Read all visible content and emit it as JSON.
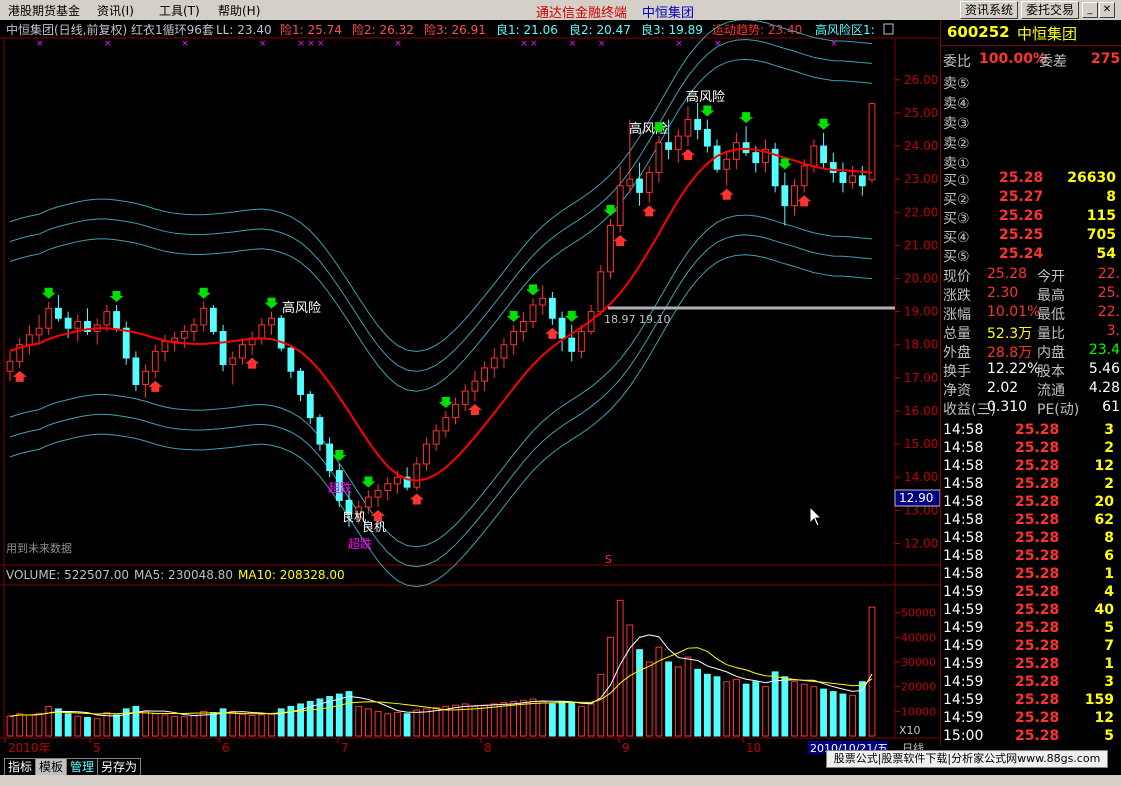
{
  "menu": {
    "items": [
      "港股期货基金",
      "资讯(I)",
      "工具(T)",
      "帮助(H)"
    ],
    "center_left": "通达信金融终端",
    "center_right": "中恒集团",
    "btn_info": "资讯系统",
    "btn_trade": "委托交易"
  },
  "colors": {
    "bg": "#000000",
    "up": "#ff3232",
    "down": "#54ffff",
    "ma": "#ff0000",
    "band": "#3fa0b0",
    "axis": "#c00000",
    "label_yellow": "#ffff00",
    "label_purple": "#ff00ff"
  },
  "indicator_line": {
    "title": "中恒集团(日线,前复权) 红衣1循环96套",
    "ll": "LL: 23.40",
    "xian1": "险1: 25.74",
    "xian2": "险2: 26.32",
    "xian3": "险3: 26.91",
    "liang1": "良1: 21.06",
    "liang2": "良2: 20.47",
    "liang3": "良3: 19.89",
    "trend": "运动趋势: 23.40",
    "risk": "高风险区1:"
  },
  "chart_annotations": {
    "high_risk": "高风险",
    "good": "良机",
    "hot": "超跌",
    "level_label": "18.97 19.10",
    "future_data": "用到未来数据",
    "cursor_price": "12.90",
    "s_mark": "S"
  },
  "volume_line": {
    "volume": "VOLUME: 522507.00",
    "ma5": "MA5: 230048.80",
    "ma10": "MA10: 208328.00",
    "x10": "X10"
  },
  "time_axis": {
    "labels": [
      "2010年",
      "5",
      "6",
      "7",
      "8",
      "9",
      "10"
    ],
    "current_date": "2010/10/21/五",
    "end_label": "日线"
  },
  "bottom_tabs": [
    "指标",
    "模板",
    "管理",
    "另存为"
  ],
  "promo": "股票公式|股票软件下载|分析家公式网www.88gs.com",
  "quote": {
    "code": "600252",
    "name": "中恒集团",
    "weibi_label": "委比",
    "weibi_value": "100.00%",
    "weicha_label": "委差",
    "weicha_value": "275",
    "sell": [
      {
        "label": "卖⑤",
        "price": "",
        "vol": ""
      },
      {
        "label": "卖④",
        "price": "",
        "vol": ""
      },
      {
        "label": "卖③",
        "price": "",
        "vol": ""
      },
      {
        "label": "卖②",
        "price": "",
        "vol": ""
      },
      {
        "label": "卖①",
        "price": "",
        "vol": ""
      }
    ],
    "buy": [
      {
        "label": "买①",
        "price": "25.28",
        "vol": "26630"
      },
      {
        "label": "买②",
        "price": "25.27",
        "vol": "8"
      },
      {
        "label": "买③",
        "price": "25.26",
        "vol": "115"
      },
      {
        "label": "买④",
        "price": "25.25",
        "vol": "705"
      },
      {
        "label": "买⑤",
        "price": "25.24",
        "vol": "54"
      }
    ],
    "stats": [
      {
        "l1": "现价",
        "v1": "25.28",
        "c1": "#ff3232",
        "l2": "今开",
        "v2": "22.",
        "c2": "#ff3232"
      },
      {
        "l1": "涨跌",
        "v1": "2.30",
        "c1": "#ff3232",
        "l2": "最高",
        "v2": "25.",
        "c2": "#ff3232"
      },
      {
        "l1": "涨幅",
        "v1": "10.01%",
        "c1": "#ff3232",
        "l2": "最低",
        "v2": "22.",
        "c2": "#ff3232"
      },
      {
        "l1": "总量",
        "v1": "52.3万",
        "c1": "#ffff00",
        "l2": "量比",
        "v2": "3.",
        "c2": "#ff3232"
      },
      {
        "l1": "外盘",
        "v1": "28.8万",
        "c1": "#ff3232",
        "l2": "内盘",
        "v2": "23.4",
        "c2": "#00ff00"
      },
      {
        "l1": "换手",
        "v1": "12.22%",
        "c1": "#ffffff",
        "l2": "股本",
        "v2": "5.46",
        "c2": "#ffffff"
      },
      {
        "l1": "净资",
        "v1": "2.02",
        "c1": "#ffffff",
        "l2": "流通",
        "v2": "4.28",
        "c2": "#ffffff"
      },
      {
        "l1": "收益(三)",
        "v1": "0.310",
        "c1": "#ffffff",
        "l2": "PE(动)",
        "v2": "61",
        "c2": "#ffffff"
      }
    ],
    "ticks": [
      {
        "time": "14:58",
        "price": "25.28",
        "vol": "3"
      },
      {
        "time": "14:58",
        "price": "25.28",
        "vol": "2"
      },
      {
        "time": "14:58",
        "price": "25.28",
        "vol": "12"
      },
      {
        "time": "14:58",
        "price": "25.28",
        "vol": "2"
      },
      {
        "time": "14:58",
        "price": "25.28",
        "vol": "20"
      },
      {
        "time": "14:58",
        "price": "25.28",
        "vol": "62"
      },
      {
        "time": "14:58",
        "price": "25.28",
        "vol": "8"
      },
      {
        "time": "14:58",
        "price": "25.28",
        "vol": "6"
      },
      {
        "time": "14:58",
        "price": "25.28",
        "vol": "1"
      },
      {
        "time": "14:59",
        "price": "25.28",
        "vol": "4"
      },
      {
        "time": "14:59",
        "price": "25.28",
        "vol": "40"
      },
      {
        "time": "14:59",
        "price": "25.28",
        "vol": "5"
      },
      {
        "time": "14:59",
        "price": "25.28",
        "vol": "7"
      },
      {
        "time": "14:59",
        "price": "25.28",
        "vol": "1"
      },
      {
        "time": "14:59",
        "price": "25.28",
        "vol": "3"
      },
      {
        "time": "14:59",
        "price": "25.28",
        "vol": "159"
      },
      {
        "time": "14:59",
        "price": "25.28",
        "vol": "12"
      },
      {
        "time": "15:00",
        "price": "25.28",
        "vol": "5"
      }
    ]
  },
  "chart_data": {
    "type": "candlestick",
    "price_axis": {
      "min": 11.5,
      "max": 26.9,
      "ticks": [
        12.0,
        13.0,
        14.0,
        15.0,
        16.0,
        17.0,
        18.0,
        19.0,
        20.0,
        21.0,
        22.0,
        23.0,
        24.0,
        25.0,
        26.0
      ]
    },
    "volume_axis": {
      "min": 0,
      "max": 60000,
      "ticks": [
        10000,
        20000,
        30000,
        40000,
        50000
      ]
    },
    "candles": [
      [
        17.2,
        17.8,
        16.9,
        17.5,
        8000
      ],
      [
        17.5,
        18.2,
        17.3,
        18.0,
        9000
      ],
      [
        18.0,
        18.6,
        17.7,
        18.3,
        8500
      ],
      [
        18.3,
        18.9,
        18.0,
        18.5,
        9200
      ],
      [
        18.5,
        19.3,
        18.3,
        19.1,
        12000
      ],
      [
        19.1,
        19.5,
        18.7,
        18.8,
        11000
      ],
      [
        18.8,
        19.0,
        18.2,
        18.5,
        9000
      ],
      [
        18.5,
        18.9,
        18.1,
        18.7,
        8000
      ],
      [
        18.7,
        19.1,
        18.3,
        18.4,
        7500
      ],
      [
        18.4,
        18.8,
        18.0,
        18.6,
        7000
      ],
      [
        18.6,
        19.2,
        18.4,
        19.0,
        9500
      ],
      [
        19.0,
        19.2,
        18.4,
        18.5,
        8500
      ],
      [
        18.5,
        18.7,
        17.4,
        17.6,
        11000
      ],
      [
        17.6,
        17.8,
        16.6,
        16.8,
        12000
      ],
      [
        16.8,
        17.4,
        16.4,
        17.2,
        10000
      ],
      [
        17.2,
        18.0,
        17.0,
        17.8,
        9000
      ],
      [
        17.8,
        18.3,
        17.5,
        18.1,
        8500
      ],
      [
        18.1,
        18.4,
        17.8,
        18.2,
        8000
      ],
      [
        18.2,
        18.6,
        17.9,
        18.4,
        7800
      ],
      [
        18.4,
        18.8,
        18.1,
        18.6,
        8200
      ],
      [
        18.6,
        19.3,
        18.4,
        19.1,
        10000
      ],
      [
        19.1,
        19.2,
        18.3,
        18.4,
        9500
      ],
      [
        18.4,
        18.6,
        17.2,
        17.4,
        11000
      ],
      [
        17.4,
        17.8,
        16.8,
        17.6,
        10000
      ],
      [
        17.6,
        18.2,
        17.4,
        18.0,
        8800
      ],
      [
        18.0,
        18.4,
        17.7,
        18.2,
        8300
      ],
      [
        18.2,
        18.8,
        18.0,
        18.6,
        8600
      ],
      [
        18.6,
        19.0,
        18.3,
        18.8,
        9000
      ],
      [
        18.8,
        18.9,
        17.8,
        17.9,
        11000
      ],
      [
        17.9,
        18.0,
        17.0,
        17.2,
        12000
      ],
      [
        17.2,
        17.3,
        16.3,
        16.5,
        13000
      ],
      [
        16.5,
        16.6,
        15.6,
        15.8,
        14000
      ],
      [
        15.8,
        15.9,
        14.8,
        15.0,
        15000
      ],
      [
        15.0,
        15.2,
        14.0,
        14.2,
        16000
      ],
      [
        14.2,
        14.4,
        13.1,
        13.3,
        17000
      ],
      [
        13.3,
        13.6,
        12.5,
        12.9,
        18000
      ],
      [
        12.9,
        13.3,
        12.6,
        13.1,
        12000
      ],
      [
        13.1,
        13.6,
        12.9,
        13.4,
        11000
      ],
      [
        13.4,
        13.8,
        13.1,
        13.6,
        10000
      ],
      [
        13.6,
        14.0,
        13.3,
        13.8,
        9000
      ],
      [
        13.8,
        14.2,
        13.5,
        14.0,
        9500
      ],
      [
        14.0,
        14.3,
        13.6,
        13.7,
        9000
      ],
      [
        13.7,
        14.6,
        13.6,
        14.4,
        10500
      ],
      [
        14.4,
        15.2,
        14.2,
        15.0,
        11000
      ],
      [
        15.0,
        15.6,
        14.8,
        15.4,
        11500
      ],
      [
        15.4,
        16.0,
        15.2,
        15.8,
        12000
      ],
      [
        15.8,
        16.4,
        15.6,
        16.2,
        12500
      ],
      [
        16.2,
        16.8,
        16.0,
        16.6,
        13000
      ],
      [
        16.6,
        17.2,
        16.3,
        16.9,
        12000
      ],
      [
        16.9,
        17.5,
        16.6,
        17.3,
        12500
      ],
      [
        17.3,
        17.9,
        17.0,
        17.6,
        13000
      ],
      [
        17.6,
        18.2,
        17.3,
        18.0,
        13500
      ],
      [
        18.0,
        18.6,
        17.7,
        18.4,
        14000
      ],
      [
        18.4,
        19.0,
        18.1,
        18.7,
        14500
      ],
      [
        18.7,
        19.4,
        18.5,
        19.2,
        15000
      ],
      [
        19.2,
        19.8,
        18.9,
        19.4,
        14000
      ],
      [
        19.4,
        19.6,
        18.6,
        18.8,
        13000
      ],
      [
        18.8,
        19.0,
        17.8,
        18.2,
        14000
      ],
      [
        18.2,
        18.6,
        17.5,
        17.8,
        13500
      ],
      [
        17.8,
        18.6,
        17.6,
        18.4,
        12000
      ],
      [
        18.4,
        19.2,
        18.3,
        19.0,
        13000
      ],
      [
        19.0,
        20.4,
        18.9,
        20.2,
        25000
      ],
      [
        20.2,
        21.8,
        20.0,
        21.6,
        40000
      ],
      [
        21.6,
        23.4,
        21.4,
        22.8,
        55000
      ],
      [
        22.8,
        24.8,
        22.6,
        23.0,
        45000
      ],
      [
        23.0,
        23.5,
        22.2,
        22.6,
        35000
      ],
      [
        22.6,
        23.4,
        22.3,
        23.2,
        30000
      ],
      [
        23.2,
        24.3,
        22.9,
        24.1,
        36000
      ],
      [
        24.1,
        24.8,
        23.6,
        23.9,
        30000
      ],
      [
        23.9,
        24.5,
        23.5,
        24.3,
        28000
      ],
      [
        24.3,
        25.2,
        24.0,
        24.8,
        32000
      ],
      [
        24.8,
        25.3,
        24.2,
        24.5,
        27000
      ],
      [
        24.5,
        24.8,
        23.8,
        24.0,
        25000
      ],
      [
        24.0,
        24.2,
        23.2,
        23.3,
        24000
      ],
      [
        23.3,
        23.8,
        22.8,
        23.6,
        22000
      ],
      [
        23.6,
        24.4,
        23.3,
        24.1,
        23000
      ],
      [
        24.1,
        24.6,
        23.7,
        23.8,
        21000
      ],
      [
        23.8,
        24.0,
        23.2,
        23.5,
        22000
      ],
      [
        23.5,
        24.2,
        23.2,
        23.9,
        20000
      ],
      [
        23.9,
        24.1,
        22.6,
        22.8,
        26000
      ],
      [
        22.8,
        23.2,
        21.6,
        22.2,
        24000
      ],
      [
        22.2,
        23.0,
        21.9,
        22.8,
        22000
      ],
      [
        22.8,
        23.6,
        22.6,
        23.4,
        21000
      ],
      [
        23.4,
        24.2,
        23.2,
        24.0,
        20000
      ],
      [
        24.0,
        24.4,
        23.3,
        23.5,
        19000
      ],
      [
        23.5,
        23.8,
        22.9,
        23.2,
        18000
      ],
      [
        23.2,
        23.5,
        22.6,
        22.9,
        17000
      ],
      [
        22.9,
        23.4,
        22.7,
        23.1,
        16500
      ],
      [
        23.1,
        23.4,
        22.5,
        22.8,
        22000
      ],
      [
        22.98,
        25.3,
        22.9,
        25.28,
        52250
      ]
    ]
  }
}
